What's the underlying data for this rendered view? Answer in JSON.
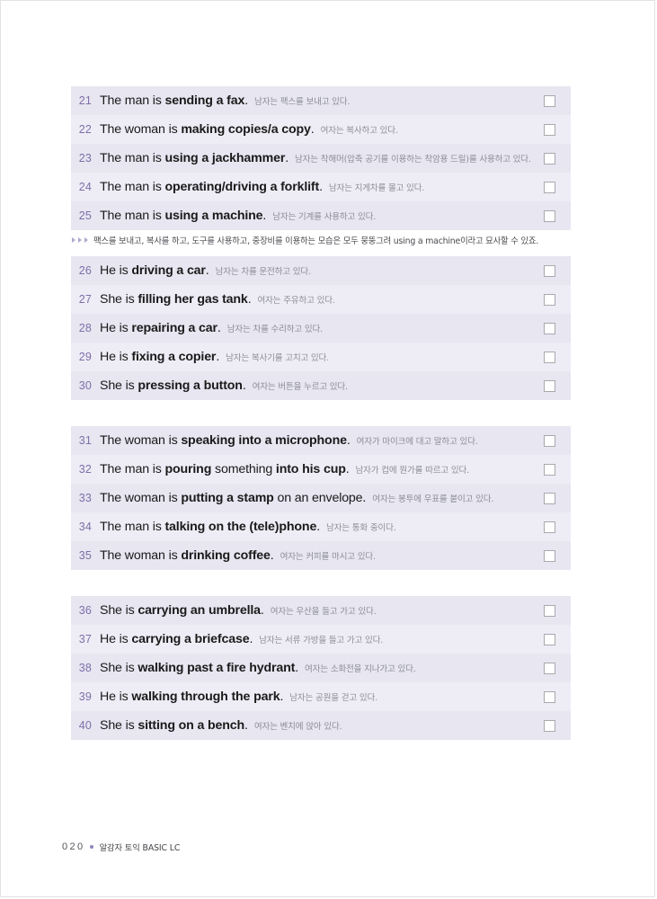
{
  "page": {
    "folio": "020",
    "book_title": "알감자 토익 BASIC LC"
  },
  "note": {
    "text": "팩스를 보내고, 복사를 하고, 도구를 사용하고, 중장비를 이용하는 모습은 모두 뭉뚱그려 using a machine이라고 묘사할 수 있죠."
  },
  "colors": {
    "row_dark": "#e7e6f1",
    "row_light": "#eeedf6",
    "number": "#7f6fa8",
    "korean": "#8d8d96",
    "accent_dot": "#8d86bd"
  },
  "groups": [
    {
      "rows": [
        {
          "num": "21",
          "pre": "The man is ",
          "bold": "sending a fax",
          "post": ".",
          "kr": "남자는 팩스를 보내고 있다."
        },
        {
          "num": "22",
          "pre": "The woman is ",
          "bold": "making copies/a copy",
          "post": ".",
          "kr": "여자는 복사하고 있다."
        },
        {
          "num": "23",
          "pre": "The man is ",
          "bold": "using a jackhammer",
          "post": ".",
          "kr": "남자는 착해머(압축 공기를 이용하는 착암용 드릴)를 사용하고 있다."
        },
        {
          "num": "24",
          "pre": "The man is ",
          "bold": "operating/driving a forklift",
          "post": ".",
          "kr": "남자는 지게차를 몰고 있다."
        },
        {
          "num": "25",
          "pre": "The man is ",
          "bold": "using a machine",
          "post": ".",
          "kr": "남자는 기계를 사용하고 있다."
        }
      ]
    },
    {
      "rows": [
        {
          "num": "26",
          "pre": "He is ",
          "bold": "driving a car",
          "post": ".",
          "kr": "남자는 차를 운전하고 있다."
        },
        {
          "num": "27",
          "pre": "She is ",
          "bold": "filling her gas tank",
          "post": ".",
          "kr": "여자는 주유하고 있다."
        },
        {
          "num": "28",
          "pre": "He is ",
          "bold": "repairing a car",
          "post": ".",
          "kr": "남자는 차를 수리하고 있다."
        },
        {
          "num": "29",
          "pre": "He is ",
          "bold": "fixing a copier",
          "post": ".",
          "kr": "남자는 복사기를 고치고 있다."
        },
        {
          "num": "30",
          "pre": "She is ",
          "bold": "pressing a button",
          "post": ".",
          "kr": "여자는 버튼을 누르고 있다."
        }
      ]
    },
    {
      "rows": [
        {
          "num": "31",
          "pre": "The woman is ",
          "bold": "speaking into a microphone",
          "post": ".",
          "kr": "여자가 마이크에 대고 말하고 있다."
        },
        {
          "num": "32",
          "pre": "The man is ",
          "bold": "pouring",
          "mid": " something ",
          "bold2": "into his cup",
          "post": ".",
          "kr": "남자가 컵에 뭔가를 따르고 있다."
        },
        {
          "num": "33",
          "pre": "The woman is ",
          "bold": "putting a stamp",
          "post": " on an envelope.",
          "kr": "여자는 봉투에 우표를 붙이고 있다."
        },
        {
          "num": "34",
          "pre": "The man is ",
          "bold": "talking on the (tele)phone",
          "post": ".",
          "kr": "남자는 통화 중이다."
        },
        {
          "num": "35",
          "pre": "The woman is ",
          "bold": "drinking coffee",
          "post": ".",
          "kr": "여자는 커피를 마시고 있다."
        }
      ]
    },
    {
      "rows": [
        {
          "num": "36",
          "pre": "She is ",
          "bold": "carrying an umbrella",
          "post": ".",
          "kr": "여자는 우산을 들고 가고 있다."
        },
        {
          "num": "37",
          "pre": "He is ",
          "bold": "carrying a briefcase",
          "post": ".",
          "kr": "남자는 서류 가방을 들고 가고 있다."
        },
        {
          "num": "38",
          "pre": "She is ",
          "bold": "walking past a fire hydrant",
          "post": ".",
          "kr": "여자는 소화전을 지나가고 있다."
        },
        {
          "num": "39",
          "pre": "He is ",
          "bold": "walking through the park",
          "post": ".",
          "kr": "남자는 공원을 걷고 있다."
        },
        {
          "num": "40",
          "pre": "She is ",
          "bold": "sitting on a bench",
          "post": ".",
          "kr": "여자는 벤치에 앉아 있다."
        }
      ]
    }
  ]
}
